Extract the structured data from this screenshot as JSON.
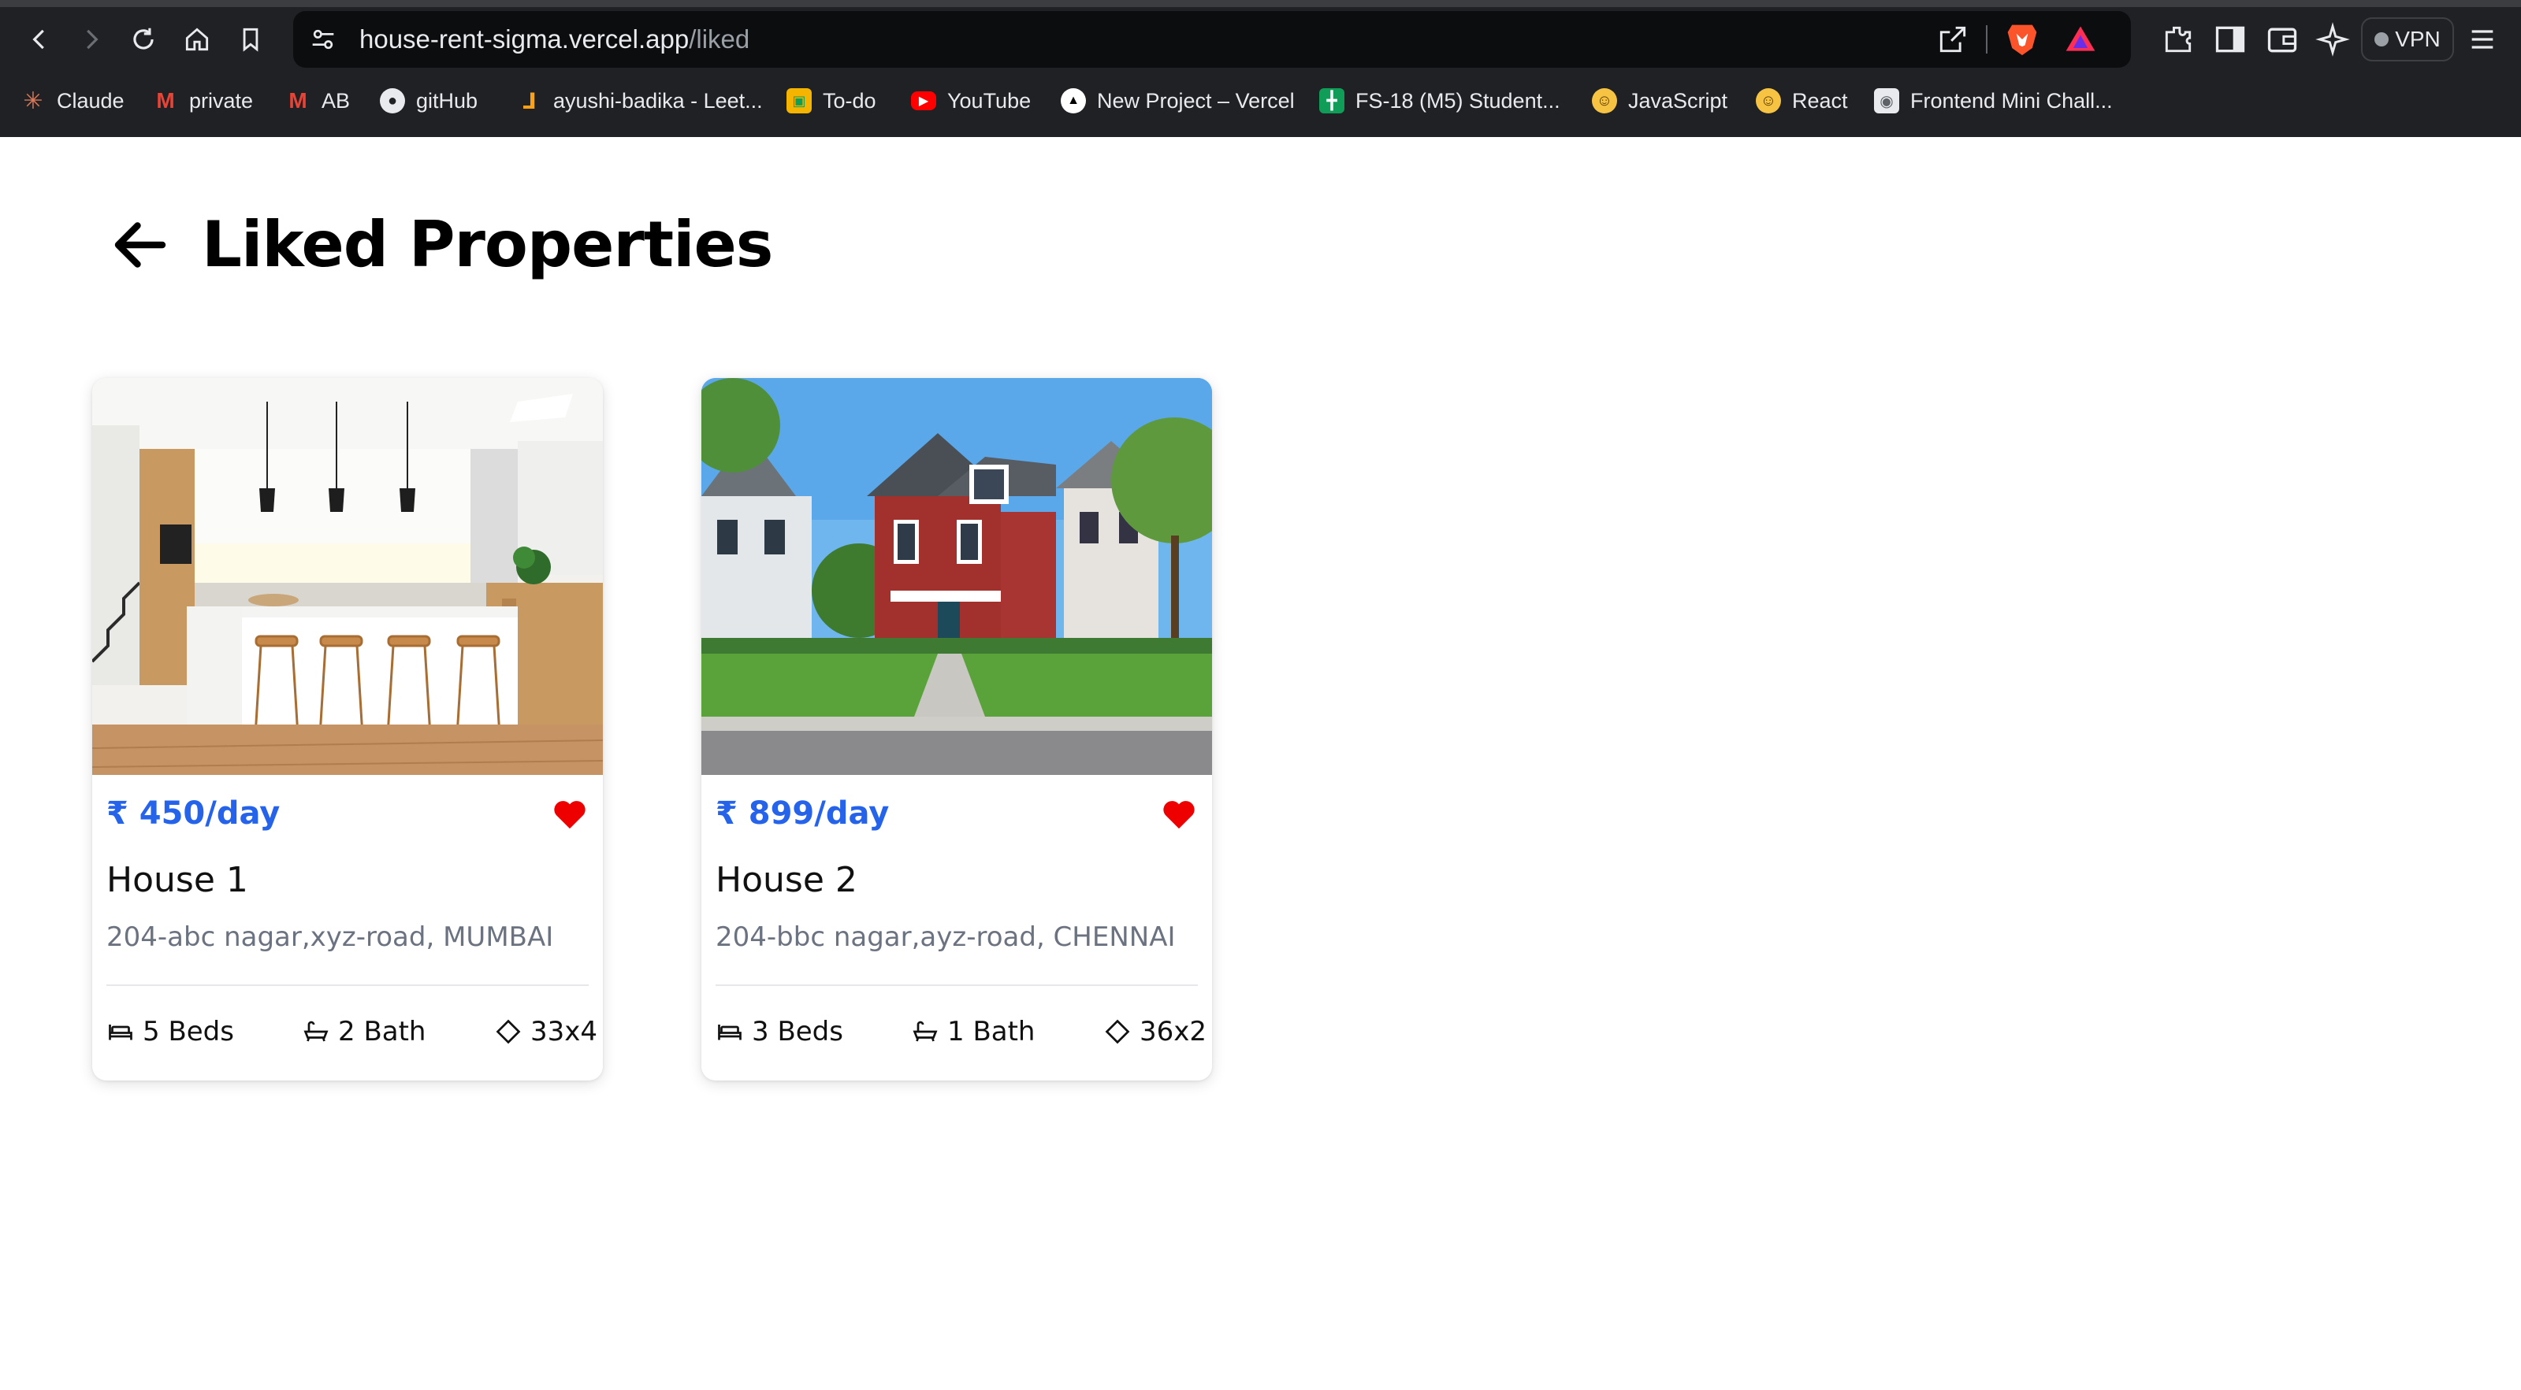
{
  "browser": {
    "url_host": "house-rent-sigma.vercel.app",
    "url_path": "/liked",
    "vpn_label": "VPN",
    "bookmarks": [
      {
        "label": "Claude",
        "icon": "claude-icon"
      },
      {
        "label": "private",
        "icon": "gmail-icon"
      },
      {
        "label": "AB",
        "icon": "gmail-icon"
      },
      {
        "label": "gitHub",
        "icon": "github-icon"
      },
      {
        "label": "ayushi-badika - Leet...",
        "icon": "leetcode-icon"
      },
      {
        "label": "To-do",
        "icon": "todo-icon"
      },
      {
        "label": "YouTube",
        "icon": "youtube-icon"
      },
      {
        "label": "New Project – Vercel",
        "icon": "vercel-icon"
      },
      {
        "label": "FS-18 (M5) Student...",
        "icon": "sheets-icon"
      },
      {
        "label": "JavaScript",
        "icon": "emoji-icon"
      },
      {
        "label": "React",
        "icon": "emoji-icon"
      },
      {
        "label": "Frontend Mini Chall...",
        "icon": "page-icon"
      }
    ]
  },
  "page": {
    "title": "Liked Properties"
  },
  "properties": [
    {
      "price": "₹ 450/day",
      "name": "House 1",
      "address": "204-abc nagar,xyz-road, MUMBAI",
      "beds": "5 Beds",
      "baths": "2 Bath",
      "size": "33x4",
      "liked": true
    },
    {
      "price": "₹ 899/day",
      "name": "House 2",
      "address": "204-bbc nagar,ayz-road, CHENNAI",
      "beds": "3 Beds",
      "baths": "1 Bath",
      "size": "36x2",
      "liked": true
    }
  ],
  "colors": {
    "price": "#2563eb",
    "heart": "#ef0000",
    "chrome_bg": "#202124"
  }
}
